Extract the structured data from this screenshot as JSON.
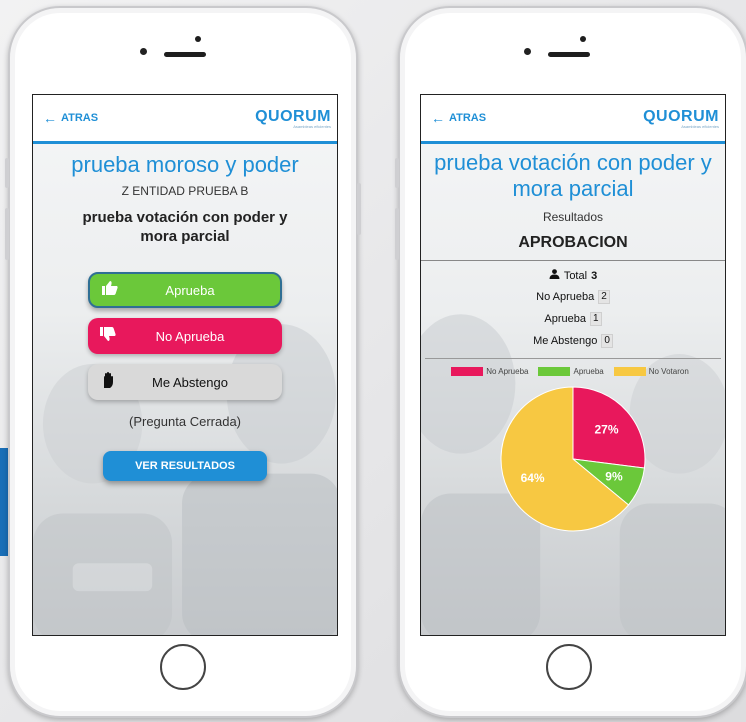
{
  "left_phone": {
    "back_label": "ATRAS",
    "logo_text": "QUORUM",
    "logo_sub": "Asambleas eficientes",
    "title": "prueba moroso y poder",
    "entity": "Z ENTIDAD PRUEBA B",
    "question": "prueba votación con poder y mora parcial",
    "options": [
      {
        "label": "Aprueba",
        "icon": "thumbs-up-icon"
      },
      {
        "label": "No Aprueba",
        "icon": "thumbs-down-icon"
      },
      {
        "label": "Me Abstengo",
        "icon": "hand-icon"
      }
    ],
    "status": "(Pregunta Cerrada)",
    "results_button": "VER RESULTADOS"
  },
  "right_phone": {
    "back_label": "ATRAS",
    "logo_text": "QUORUM",
    "logo_sub": "Asambleas eficientes",
    "title": "prueba votación con poder y mora parcial",
    "subtitle": "Resultados",
    "heading": "APROBACION",
    "total_label": "Total",
    "total_value": "3",
    "stats": [
      {
        "label": "No Aprueba",
        "value": "2"
      },
      {
        "label": "Aprueba",
        "value": "1"
      },
      {
        "label": "Me Abstengo",
        "value": "0"
      }
    ]
  },
  "colors": {
    "brand": "#1f8fd6",
    "aprueba": "#6bc83a",
    "no_aprueba": "#e8185c",
    "no_votaron": "#f7c842",
    "abstengo": "#d9d9d9"
  },
  "chart_data": {
    "type": "pie",
    "legend_position": "top",
    "slices": [
      {
        "name": "No Aprueba",
        "value": 27,
        "label": "27%",
        "color": "#e8185c"
      },
      {
        "name": "Aprueba",
        "value": 9,
        "label": "9%",
        "color": "#6bc83a"
      },
      {
        "name": "No Votaron",
        "value": 64,
        "label": "64%",
        "color": "#f7c842"
      }
    ]
  }
}
